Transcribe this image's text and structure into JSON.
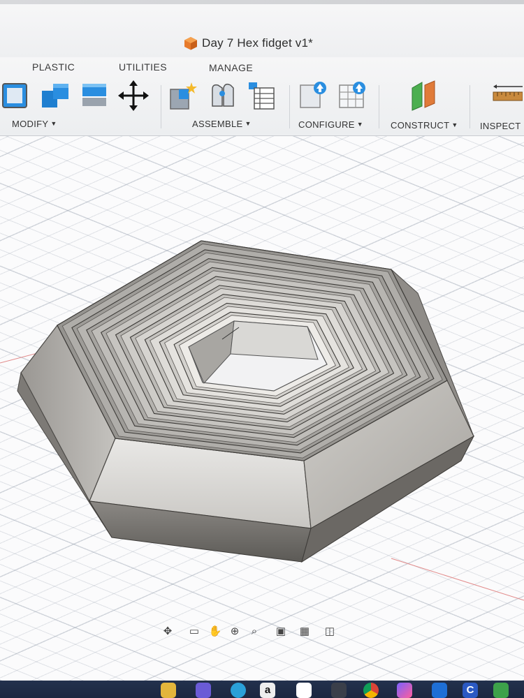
{
  "document": {
    "title": "Day 7 Hex fidget v1*"
  },
  "tabs": [
    {
      "label": "PLASTIC"
    },
    {
      "label": "UTILITIES"
    },
    {
      "label": "MANAGE"
    }
  ],
  "groups": [
    {
      "label": "MODIFY"
    },
    {
      "label": "ASSEMBLE"
    },
    {
      "label": "CONFIGURE"
    },
    {
      "label": "CONSTRUCT"
    },
    {
      "label": "INSPECT"
    }
  ],
  "colors": {
    "accent_blue": "#2a8ee0",
    "construct_green": "#4caf50",
    "construct_orange": "#e07b39",
    "model_face_light": "#dcdad6",
    "model_face_dark": "#6f6c68",
    "taskbar": "#1f2b45"
  },
  "taskbar": {
    "amazon_label": "a",
    "badge_label": "C"
  }
}
